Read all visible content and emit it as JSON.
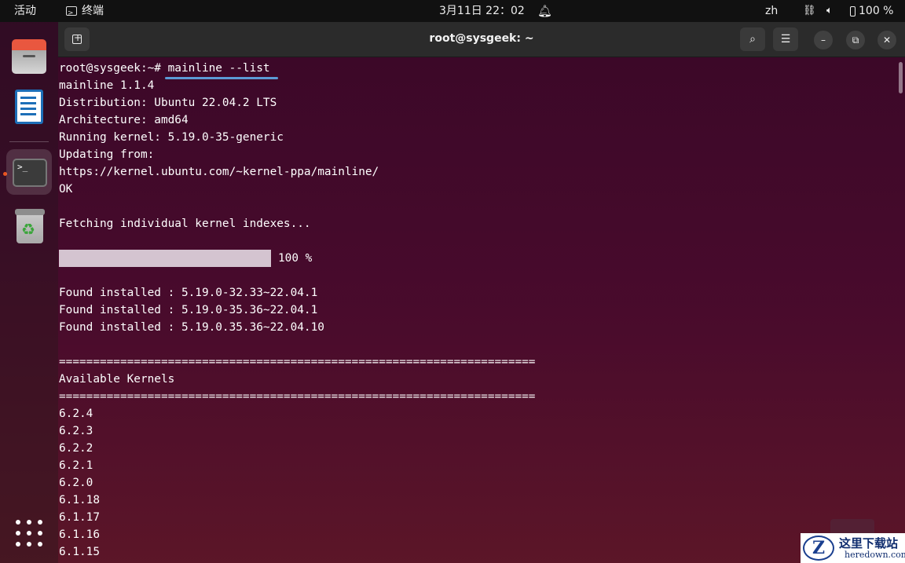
{
  "topbar": {
    "activities": "活动",
    "app_name": "终端",
    "clock": "3月11日  22：02",
    "language": "zh",
    "battery": "100 %"
  },
  "window": {
    "title": "root@sysgeek: ~"
  },
  "terminal": {
    "prompt": "root@sysgeek:~# ",
    "command": "mainline --list",
    "lines_before_progress": [
      "mainline 1.1.4",
      "Distribution: Ubuntu 22.04.2 LTS",
      "Architecture: amd64",
      "Running kernel: 5.19.0-35-generic",
      "Updating from:",
      "https://kernel.ubuntu.com/~kernel-ppa/mainline/",
      "OK",
      "",
      "Fetching individual kernel indexes...",
      ""
    ],
    "progress_percent": 100,
    "progress_label": "100 %",
    "lines_after_progress": [
      "",
      "Found installed : 5.19.0-32.33~22.04.1",
      "Found installed : 5.19.0-35.36~22.04.1",
      "Found installed : 5.19.0.35.36~22.04.10",
      "",
      "======================================================================",
      "Available Kernels",
      "======================================================================",
      "6.2.4",
      "6.2.3",
      "6.2.2",
      "6.2.1",
      "6.2.0",
      "6.1.18",
      "6.1.17",
      "6.1.16",
      "6.1.15"
    ]
  },
  "watermark": {
    "logo_letter": "Z",
    "title": "这里下载站",
    "url": "heredown.com"
  },
  "colors": {
    "terminal_bg": "#4a0c36",
    "accent_dot": "#e95420",
    "underline": "#5b9bd5"
  }
}
